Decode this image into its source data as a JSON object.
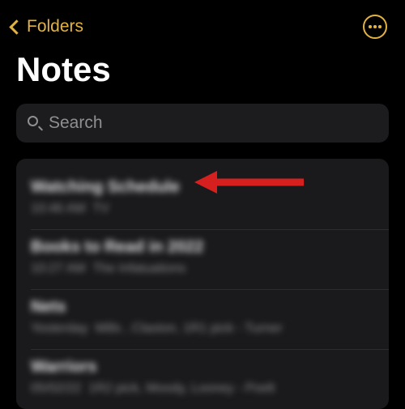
{
  "header": {
    "back_label": "Folders"
  },
  "page": {
    "title": "Notes"
  },
  "search": {
    "placeholder": "Search"
  },
  "notes": [
    {
      "title": "Watching Schedule",
      "time": "10:46 AM",
      "preview": "TV"
    },
    {
      "title": "Books to Read in 2022",
      "time": "10:27 AM",
      "preview": "The Infatuations"
    },
    {
      "title": "Nets",
      "time": "Yesterday",
      "preview": "Mills , Claxton, 1R1 pick - Turner"
    },
    {
      "title": "Warriors",
      "time": "05/02/22",
      "preview": "1R2 pick, Moody, Looney - Poelt"
    }
  ],
  "colors": {
    "accent": "#e3b341",
    "annotation": "#d62020"
  }
}
